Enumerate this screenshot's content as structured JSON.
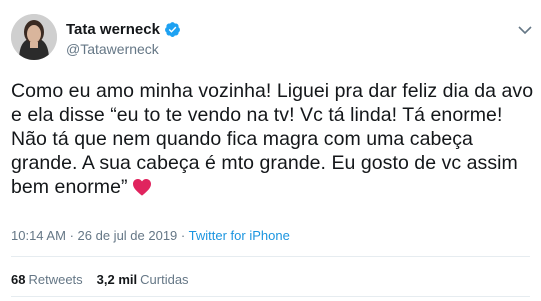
{
  "author": {
    "display_name": "Tata werneck",
    "handle": "@Tatawerneck",
    "verified_icon": "verified-badge-icon",
    "avatar_icon": "avatar-photo"
  },
  "tweet": {
    "text": "Como eu amo minha vozinha! Liguei pra dar feliz dia da avo e ela disse “eu to te vendo na tv! Vc tá linda! Tá enorme! Não tá que nem quando fica magra com uma cabeça grande. A sua cabeça é mto grande. Eu gosto de vc assim bem enorme”",
    "emoji_icon": "red-heart-icon",
    "time": "10:14 AM",
    "separator": "·",
    "date": "26 de jul de 2019",
    "source": "Twitter for iPhone"
  },
  "stats": {
    "retweets_count": "68",
    "retweets_label": "Retweets",
    "likes_count": "3,2 mil",
    "likes_label": "Curtidas"
  },
  "colors": {
    "text": "#14171a",
    "muted": "#657786",
    "link": "#1b95e0",
    "verified": "#1da1f2",
    "heart": "#e0245e",
    "divider": "#e6ecf0"
  }
}
